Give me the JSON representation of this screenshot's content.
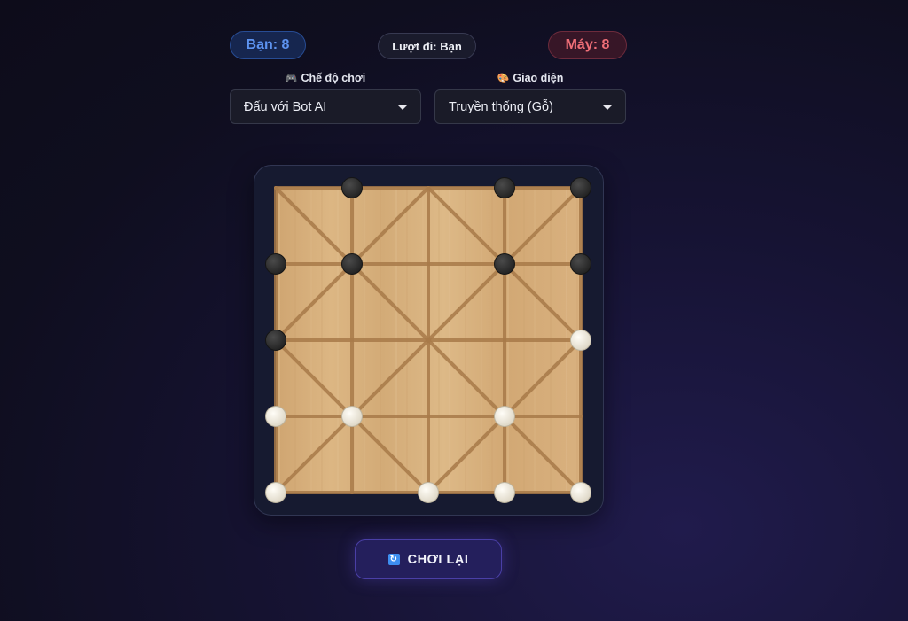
{
  "scoreboard": {
    "player": "Bạn: 8",
    "turn": "Lượt đi: Bạn",
    "bot": "Máy: 8"
  },
  "controls": {
    "mode_icon": "🎮",
    "mode_label": "Chế độ chơi",
    "mode_value": "Đấu với Bot AI",
    "theme_icon": "🎨",
    "theme_label": "Giao diện",
    "theme_value": "Truyền thống (Gỗ)"
  },
  "colors": {
    "player_accent": "#5d93f0",
    "bot_accent": "#f06f78",
    "board_wood": "#d6ae7b",
    "board_line": "#a87a49",
    "black_piece": "#2c2c2c",
    "white_piece": "#ece8dc",
    "button_bg": "#241f5c"
  },
  "board": {
    "grid_size": 5,
    "pieces": [
      {
        "row": 0,
        "col": 1,
        "color": "black"
      },
      {
        "row": 0,
        "col": 3,
        "color": "black"
      },
      {
        "row": 0,
        "col": 4,
        "color": "black"
      },
      {
        "row": 1,
        "col": 0,
        "color": "black"
      },
      {
        "row": 1,
        "col": 1,
        "color": "black"
      },
      {
        "row": 1,
        "col": 3,
        "color": "black"
      },
      {
        "row": 1,
        "col": 4,
        "color": "black"
      },
      {
        "row": 2,
        "col": 0,
        "color": "black"
      },
      {
        "row": 2,
        "col": 4,
        "color": "white"
      },
      {
        "row": 3,
        "col": 0,
        "color": "white"
      },
      {
        "row": 3,
        "col": 1,
        "color": "white"
      },
      {
        "row": 3,
        "col": 3,
        "color": "white"
      },
      {
        "row": 4,
        "col": 0,
        "color": "white"
      },
      {
        "row": 4,
        "col": 2,
        "color": "white"
      },
      {
        "row": 4,
        "col": 3,
        "color": "white"
      },
      {
        "row": 4,
        "col": 4,
        "color": "white"
      }
    ]
  },
  "actions": {
    "reset_icon": "refresh-icon",
    "reset_label": "CHƠI LẠI"
  }
}
